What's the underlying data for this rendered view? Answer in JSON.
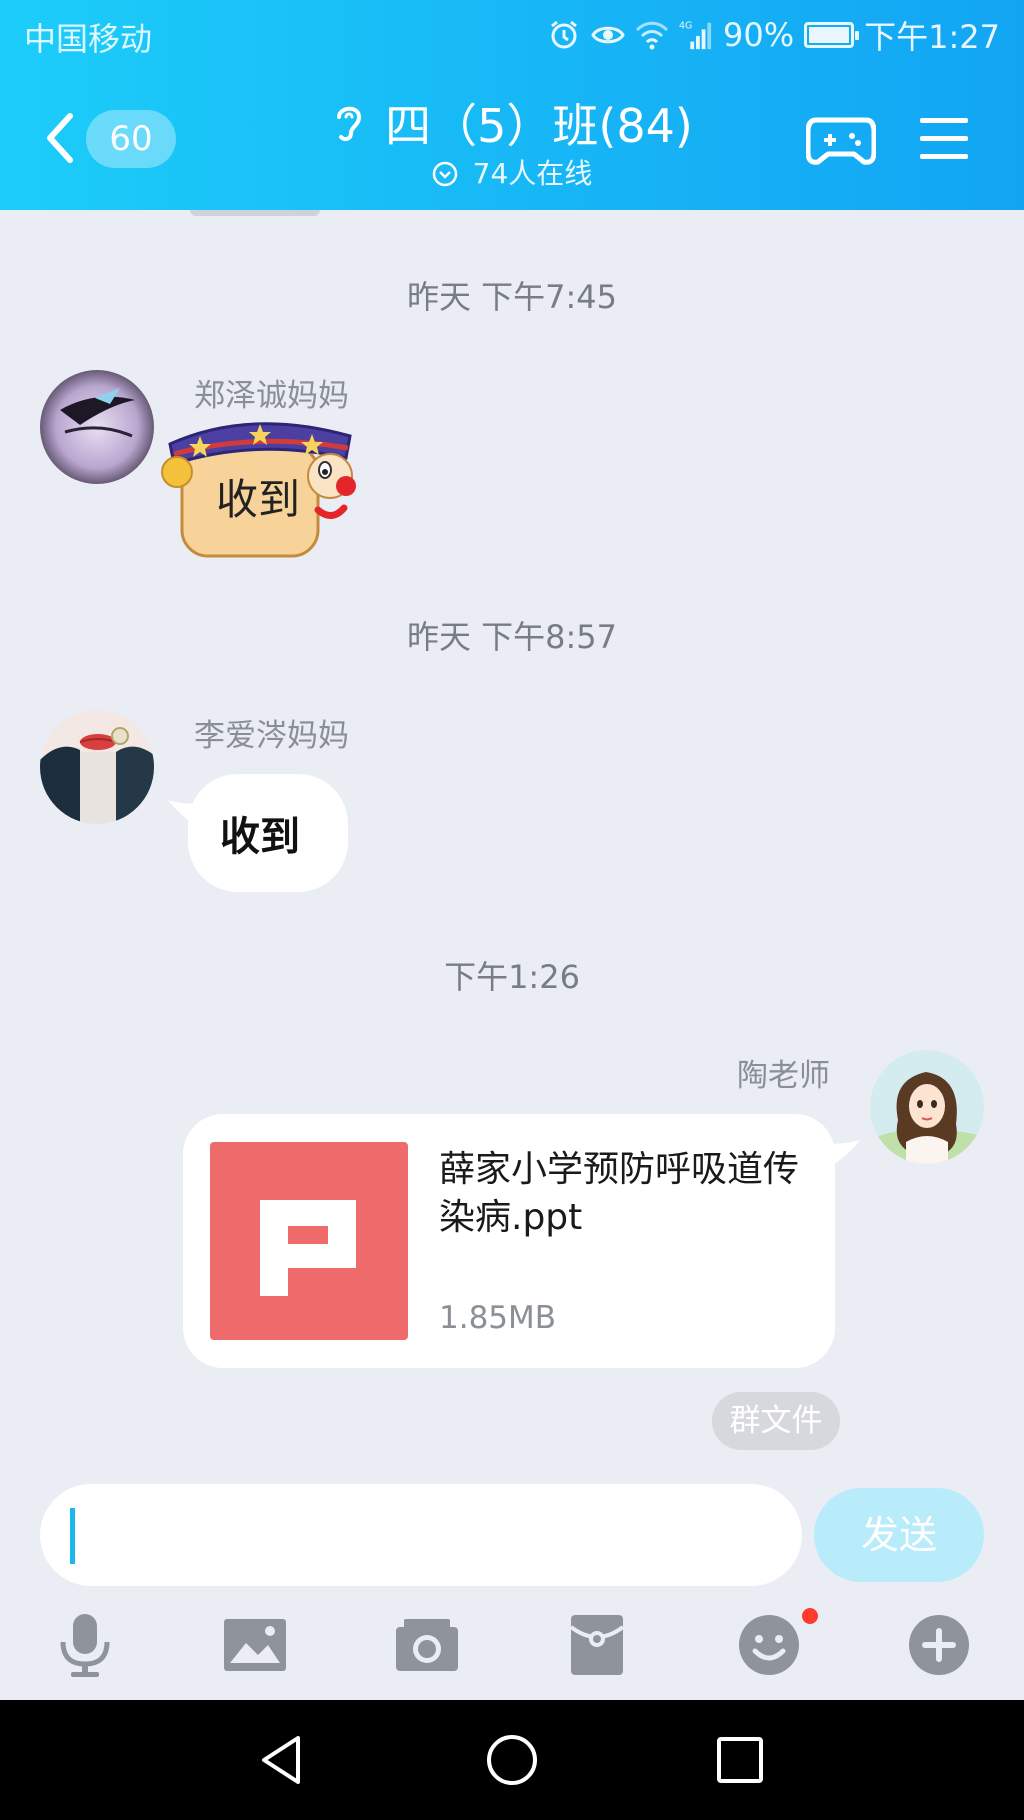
{
  "status_bar": {
    "carrier": "中国移动",
    "battery": "90%",
    "time": "下午1:27",
    "network": "4G",
    "battery_level": 0.9
  },
  "header": {
    "unread_count": "60",
    "title": "四（5）班(84)",
    "online": "74人在线"
  },
  "messages": [
    {
      "timestamp": "昨天 下午7:45",
      "sender": "郑泽诚妈妈",
      "sticker_text": "收到"
    },
    {
      "timestamp": "昨天 下午8:57",
      "sender": "李爱涔妈妈",
      "sticker_text": "收到"
    },
    {
      "timestamp": "下午1:26",
      "sender": "陶老师",
      "file": {
        "name": "薛家小学预防呼吸道传染病.ppt",
        "size": "1.85MB"
      },
      "tag": "群文件"
    }
  ],
  "input": {
    "value": "",
    "send_label": "发送"
  },
  "toolbar": [
    "microphone-icon",
    "image-icon",
    "camera-icon",
    "red-packet-icon",
    "emoji-icon",
    "plus-icon"
  ],
  "colors": {
    "header_start": "#1ccdf9",
    "header_end": "#12a5f3",
    "ppt": "#ef6b6b",
    "send_bg": "#b8ecfb",
    "caret": "#19b9ef"
  }
}
